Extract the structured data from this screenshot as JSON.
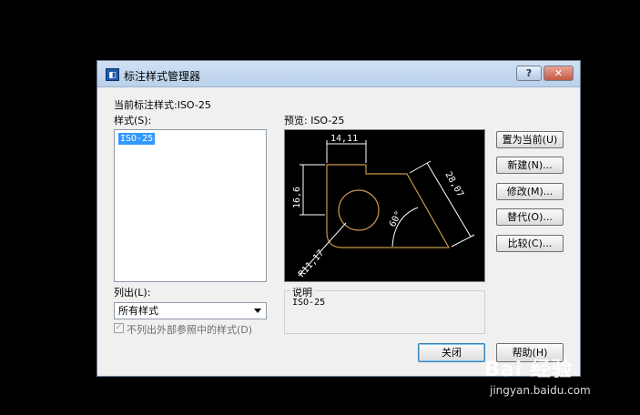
{
  "window": {
    "title": "标注样式管理器",
    "help_button": "?",
    "close_button": "✕"
  },
  "current_style": "当前标注样式:ISO-25",
  "styles_label": "样式(S):",
  "styles_list": [
    "ISO-25"
  ],
  "preview": {
    "label": "预览: ISO-25",
    "dim_top": "14,11",
    "dim_left": "16,6",
    "dim_right": "28,07",
    "dim_angle": "60°",
    "dim_radius": "R11,17"
  },
  "buttons": {
    "set_current": "置为当前(U)",
    "new": "新建(N)...",
    "modify": "修改(M)...",
    "override": "替代(O)...",
    "compare": "比较(C)...",
    "close": "关闭",
    "help": "帮助(H)"
  },
  "list_label": "列出(L):",
  "list_select": "所有样式",
  "exclude_xref": "不列出外部参照中的样式(D)",
  "description": {
    "legend": "说明",
    "text": "ISO-25"
  },
  "watermark": {
    "brand": "Bai 经验",
    "url": "jingyan.baidu.com"
  },
  "colors": {
    "dimension_line": "#ffffff",
    "geometry_line": "#c8964a"
  }
}
